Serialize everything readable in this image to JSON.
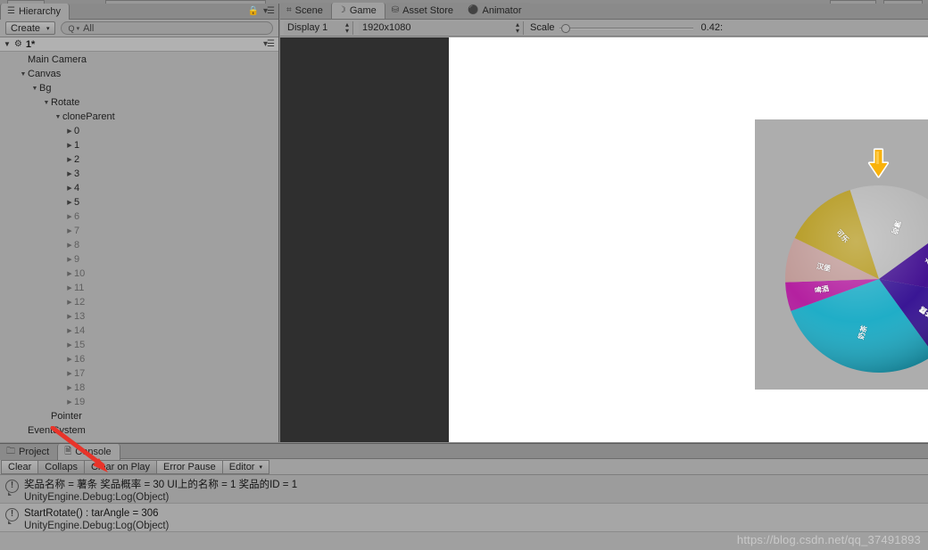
{
  "hierarchy": {
    "tab_label": "Hierarchy",
    "tab_icon": "list-icon",
    "lock_icon": "lock-icon",
    "menu_icon": "panel-menu-icon",
    "create_label": "Create",
    "create_caret": "▾",
    "search_placeholder": "All",
    "search_value": "All",
    "search_icon": "search-icon",
    "scene_name": "1*",
    "scene_icon": "unity-scene-icon",
    "nodes": [
      {
        "label": "Main Camera",
        "depth": 1,
        "arrow": "",
        "dim": false
      },
      {
        "label": "Canvas",
        "depth": 1,
        "arrow": "▼",
        "dim": false
      },
      {
        "label": "Bg",
        "depth": 2,
        "arrow": "▼",
        "dim": false
      },
      {
        "label": "Rotate",
        "depth": 3,
        "arrow": "▼",
        "dim": false
      },
      {
        "label": "cloneParent",
        "depth": 4,
        "arrow": "▼",
        "dim": false
      },
      {
        "label": "0",
        "depth": 5,
        "arrow": "▶",
        "dim": false
      },
      {
        "label": "1",
        "depth": 5,
        "arrow": "▶",
        "dim": false
      },
      {
        "label": "2",
        "depth": 5,
        "arrow": "▶",
        "dim": false
      },
      {
        "label": "3",
        "depth": 5,
        "arrow": "▶",
        "dim": false
      },
      {
        "label": "4",
        "depth": 5,
        "arrow": "▶",
        "dim": false
      },
      {
        "label": "5",
        "depth": 5,
        "arrow": "▶",
        "dim": false
      },
      {
        "label": "6",
        "depth": 5,
        "arrow": "▶",
        "dim": true
      },
      {
        "label": "7",
        "depth": 5,
        "arrow": "▶",
        "dim": true
      },
      {
        "label": "8",
        "depth": 5,
        "arrow": "▶",
        "dim": true
      },
      {
        "label": "9",
        "depth": 5,
        "arrow": "▶",
        "dim": true
      },
      {
        "label": "10",
        "depth": 5,
        "arrow": "▶",
        "dim": true
      },
      {
        "label": "11",
        "depth": 5,
        "arrow": "▶",
        "dim": true
      },
      {
        "label": "12",
        "depth": 5,
        "arrow": "▶",
        "dim": true
      },
      {
        "label": "13",
        "depth": 5,
        "arrow": "▶",
        "dim": true
      },
      {
        "label": "14",
        "depth": 5,
        "arrow": "▶",
        "dim": true
      },
      {
        "label": "15",
        "depth": 5,
        "arrow": "▶",
        "dim": true
      },
      {
        "label": "16",
        "depth": 5,
        "arrow": "▶",
        "dim": true
      },
      {
        "label": "17",
        "depth": 5,
        "arrow": "▶",
        "dim": true
      },
      {
        "label": "18",
        "depth": 5,
        "arrow": "▶",
        "dim": true
      },
      {
        "label": "19",
        "depth": 5,
        "arrow": "▶",
        "dim": true
      },
      {
        "label": "Pointer",
        "depth": 3,
        "arrow": "",
        "dim": false
      },
      {
        "label": "EventSystem",
        "depth": 1,
        "arrow": "",
        "dim": false
      }
    ]
  },
  "gameview": {
    "tabs": [
      {
        "label": "Scene",
        "icon": "grid-icon",
        "active": false
      },
      {
        "label": "Game",
        "icon": "gamepad-icon",
        "active": true
      },
      {
        "label": "Asset Store",
        "icon": "store-bag-icon",
        "active": false
      },
      {
        "label": "Animator",
        "icon": "animator-icon",
        "active": false
      }
    ],
    "display_label": "Display 1",
    "resolution_label": "1920x1080",
    "scale_label": "Scale",
    "scale_value": "0.42:",
    "scale_percent": 2
  },
  "wheel": {
    "pointer_icon": "down-arrow-pointer-icon",
    "pointer_fill": "#f9b20c",
    "pointer_stroke": "#ffffff",
    "background_color": "#adadad",
    "segments": [
      {
        "label": "薄荷",
        "color": "#b3b3b3",
        "start_deg": -18,
        "end_deg": 54,
        "label_deg": 18,
        "label_r": 0.58
      },
      {
        "label": "酰斗",
        "color": "#3a068c",
        "start_deg": 54,
        "end_deg": 100,
        "label_deg": 70,
        "label_r": 0.6
      },
      {
        "label": "茶露",
        "color": "#2f0a8f",
        "start_deg": 100,
        "end_deg": 144,
        "label_deg": 125,
        "label_r": 0.62
      },
      {
        "label": "奶茶",
        "color": "#14a9c4",
        "start_deg": 144,
        "end_deg": 250,
        "label_deg": 197,
        "label_r": 0.6
      },
      {
        "label": "啤酒",
        "color": "#b0159b",
        "start_deg": 250,
        "end_deg": 268,
        "label_deg": 259,
        "label_r": 0.62
      },
      {
        "label": "汉堡",
        "color": "#bc9592",
        "start_deg": 268,
        "end_deg": 296,
        "label_deg": 282,
        "label_r": 0.6
      },
      {
        "label": "可乐",
        "color": "#b09312",
        "start_deg": 296,
        "end_deg": 342,
        "label_deg": 319,
        "label_r": 0.6
      }
    ]
  },
  "console": {
    "tabs": [
      {
        "label": "Project",
        "icon": "folder-icon",
        "active": false
      },
      {
        "label": "Console",
        "icon": "console-icon",
        "active": true
      }
    ],
    "toolbar": [
      {
        "label": "Clear",
        "caret": "",
        "toggled": false
      },
      {
        "label": "Collaps",
        "caret": "",
        "toggled": true
      },
      {
        "label": "Clear on Play",
        "caret": "",
        "toggled": true
      },
      {
        "label": "Error Pause",
        "caret": "",
        "toggled": false
      },
      {
        "label": "Editor",
        "caret": "▾",
        "toggled": false
      }
    ],
    "logs": [
      {
        "icon": "info-log-icon",
        "message": "奖品名称 = 薯条  奖品概率 = 30  UI上的名称 = 1  奖品的ID = 1",
        "source": "UnityEngine.Debug:Log(Object)"
      },
      {
        "icon": "info-log-icon",
        "message": "StartRotate() : tarAngle = 306",
        "source": "UnityEngine.Debug:Log(Object)"
      }
    ]
  },
  "watermark": {
    "text": "https://blog.csdn.net/qq_37491893"
  },
  "annotation": {
    "arrow_color": "#e8342a",
    "name": "red-annotation-arrow"
  }
}
